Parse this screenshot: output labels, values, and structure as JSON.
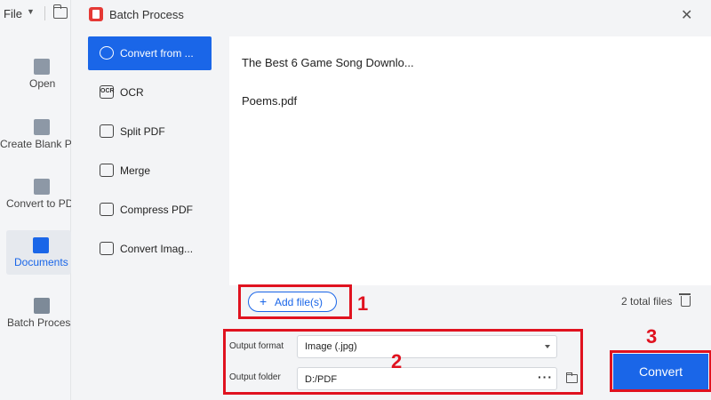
{
  "app": {
    "file_menu": "File",
    "nav": [
      {
        "label": "Open"
      },
      {
        "label": "Create Blank P"
      },
      {
        "label": "Convert to PDF"
      },
      {
        "label": "Documents"
      },
      {
        "label": "Batch Process"
      }
    ]
  },
  "dialog": {
    "title": "Batch Process",
    "categories": [
      {
        "label": "Convert from ...",
        "icon": "convert-icon",
        "active": true
      },
      {
        "label": "OCR",
        "icon": "ocr-icon"
      },
      {
        "label": "Split PDF",
        "icon": "split-icon"
      },
      {
        "label": "Merge",
        "icon": "merge-icon"
      },
      {
        "label": "Compress PDF",
        "icon": "compress-icon"
      },
      {
        "label": "Convert Imag...",
        "icon": "image-convert-icon"
      }
    ],
    "files": [
      "The Best 6 Game Song Downlo...",
      "Poems.pdf"
    ],
    "add_files_label": "Add file(s)",
    "total_files": "2 total files",
    "output": {
      "format_label": "Output format",
      "format_value": "Image (.jpg)",
      "folder_label": "Output folder",
      "folder_value": "D:/PDF",
      "folder_more": "···"
    },
    "convert_label": "Convert",
    "annotations": [
      "1",
      "2",
      "3"
    ],
    "colors": {
      "accent": "#1a66e8",
      "annotation": "#e0121f"
    }
  }
}
